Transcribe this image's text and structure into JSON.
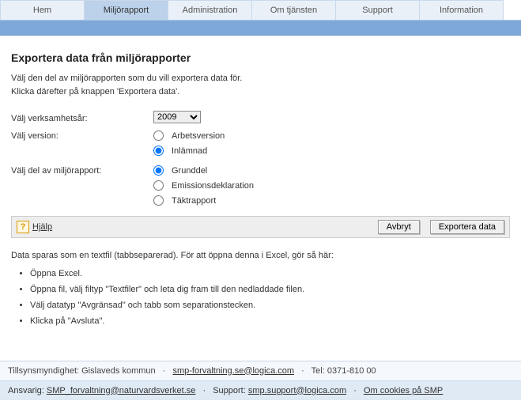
{
  "nav": {
    "tabs": [
      {
        "label": "Hem"
      },
      {
        "label": "Miljörapport"
      },
      {
        "label": "Administration"
      },
      {
        "label": "Om tjänsten"
      },
      {
        "label": "Support"
      },
      {
        "label": "Information"
      }
    ],
    "active_index": 1
  },
  "page": {
    "title": "Exportera data från miljörapporter",
    "intro_line1": "Välj den del av miljörapporten som du vill exportera data för.",
    "intro_line2": "Klicka därefter på knappen 'Exportera data'."
  },
  "form": {
    "year_label": "Välj verksamhetsår:",
    "year_value": "2009",
    "version_label": "Välj version:",
    "version_options": [
      {
        "label": "Arbetsversion",
        "checked": false
      },
      {
        "label": "Inlämnad",
        "checked": true
      }
    ],
    "part_label": "Välj del av miljörapport:",
    "part_options": [
      {
        "label": "Grunddel",
        "checked": true
      },
      {
        "label": "Emissionsdeklaration",
        "checked": false
      },
      {
        "label": "Täktrapport",
        "checked": false
      }
    ]
  },
  "actions": {
    "help_label": "Hjälp",
    "cancel_label": "Avbryt",
    "export_label": "Exportera data"
  },
  "note": {
    "text": "Data sparas som en textfil (tabbseparerad). För att öppna denna i Excel, gör så här:",
    "steps": [
      "Öppna Excel.",
      "Öppna fil, välj filtyp \"Textfiler\" och leta dig fram till den nedladdade filen.",
      "Välj datatyp \"Avgränsad\" och tabb som separationstecken.",
      "Klicka på \"Avsluta\"."
    ]
  },
  "footer": {
    "line1_prefix": "Tillsynsmyndighet: Gislaveds kommun",
    "line1_email": "smp-forvaltning.se@logica.com",
    "line1_tel": "Tel: 0371-810 00",
    "line2_ansvarig_label": "Ansvarig:",
    "line2_ansvarig_email": "SMP_forvaltning@naturvardsverket.se",
    "line2_support_label": "Support:",
    "line2_support_email": "smp.support@logica.com",
    "line2_cookies": "Om cookies på SMP"
  }
}
